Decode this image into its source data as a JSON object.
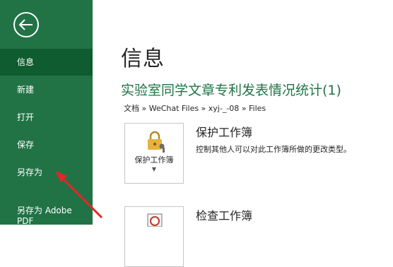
{
  "sidebar": {
    "back_icon": "back-arrow-circle-icon",
    "items": [
      {
        "label": "信息",
        "active": true
      },
      {
        "label": "新建"
      },
      {
        "label": "打开"
      },
      {
        "label": "保存"
      },
      {
        "label": "另存为"
      },
      {
        "label": "另存为 Adobe\nPDF"
      }
    ]
  },
  "main": {
    "title": "信息",
    "document_title": "实验室同学文章专利发表情况统计(1)",
    "breadcrumb": "文档 » WeChat Files » xyj-_-08 » Files",
    "protect": {
      "button_label": "保护工作簿",
      "heading": "保护工作簿",
      "description": "控制其他人可以对此工作簿所做的更改类型。",
      "icon": "lock-key-icon"
    },
    "inspect": {
      "heading": "检查工作簿",
      "icon": "check-document-icon"
    }
  },
  "colors": {
    "sidebar_bg": "#217346",
    "sidebar_active": "#0e5c2f",
    "accent_green": "#217346",
    "annotation_arrow": "#e3262a"
  }
}
